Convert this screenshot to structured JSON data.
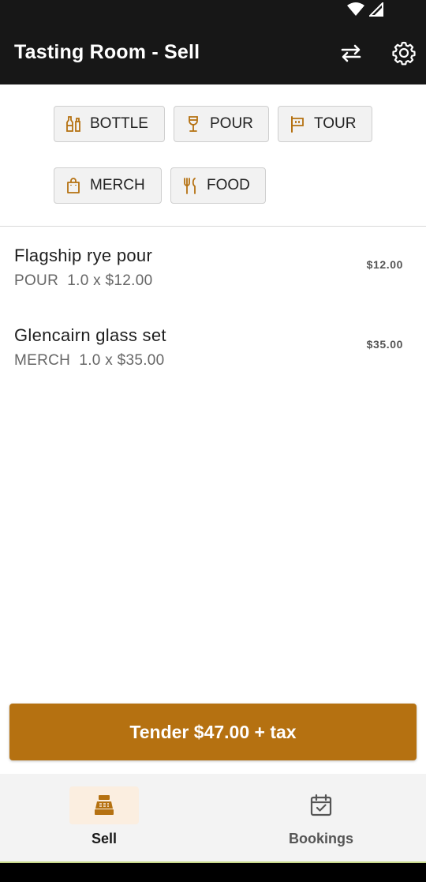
{
  "status_bar": {
    "icons": [
      "wifi-icon",
      "cell-signal-icon"
    ]
  },
  "app_bar": {
    "title": "Tasting Room - Sell",
    "actions": [
      "swap-icon",
      "settings-icon"
    ]
  },
  "categories": [
    {
      "label": "BOTTLE",
      "icon": "bottles-icon"
    },
    {
      "label": "POUR",
      "icon": "wine-glass-icon"
    },
    {
      "label": "TOUR",
      "icon": "flag-icon"
    },
    {
      "label": "MERCH",
      "icon": "shopping-bag-icon"
    },
    {
      "label": "FOOD",
      "icon": "utensils-icon"
    }
  ],
  "cart": {
    "items": [
      {
        "name": "Flagship rye pour",
        "detail": "POUR  1.0 x $12.00",
        "price": "$12.00"
      },
      {
        "name": "Glencairn glass set",
        "detail": "MERCH  1.0 x $35.00",
        "price": "$35.00"
      }
    ]
  },
  "tender_button": {
    "label": "Tender $47.00 + tax"
  },
  "bottom_nav": {
    "tabs": [
      {
        "label": "Sell",
        "icon": "cash-register-icon",
        "active": true
      },
      {
        "label": "Bookings",
        "icon": "calendar-check-icon",
        "active": false
      }
    ]
  },
  "colors": {
    "accent": "#b57111",
    "bar": "#171717",
    "active_pill": "#fbeee0"
  }
}
